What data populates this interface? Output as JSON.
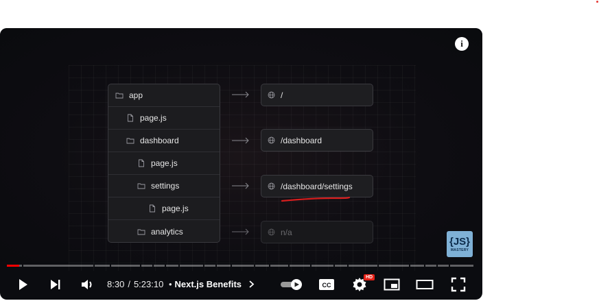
{
  "video": {
    "file_tree": [
      {
        "label": "app",
        "icon": "folder-icon",
        "level": 0
      },
      {
        "label": "page.js",
        "icon": "file-icon",
        "level": 1
      },
      {
        "label": "dashboard",
        "icon": "folder-icon",
        "level": 1
      },
      {
        "label": "page.js",
        "icon": "file-icon",
        "level": 2
      },
      {
        "label": "settings",
        "icon": "folder-icon",
        "level": 2
      },
      {
        "label": "page.js",
        "icon": "file-icon",
        "level": 3
      },
      {
        "label": "analytics",
        "icon": "folder-icon",
        "level": 2
      }
    ],
    "routes": [
      {
        "label": "/",
        "dim": false
      },
      {
        "label": "/dashboard",
        "dim": false
      },
      {
        "label": "/dashboard/settings",
        "dim": false
      },
      {
        "label": "n/a",
        "dim": true
      }
    ],
    "logo": {
      "line1": "{JS}",
      "line2": "MASTERY"
    },
    "annotation_color": "#d81e1e"
  },
  "player": {
    "current_time": "8:30",
    "duration": "5:23:10",
    "separator": "/",
    "bullet": "•",
    "chapter_title": "Next.js Benefits",
    "hd_badge": "HD",
    "progress_fraction": 0.026,
    "accent_color": "#ff0000"
  }
}
